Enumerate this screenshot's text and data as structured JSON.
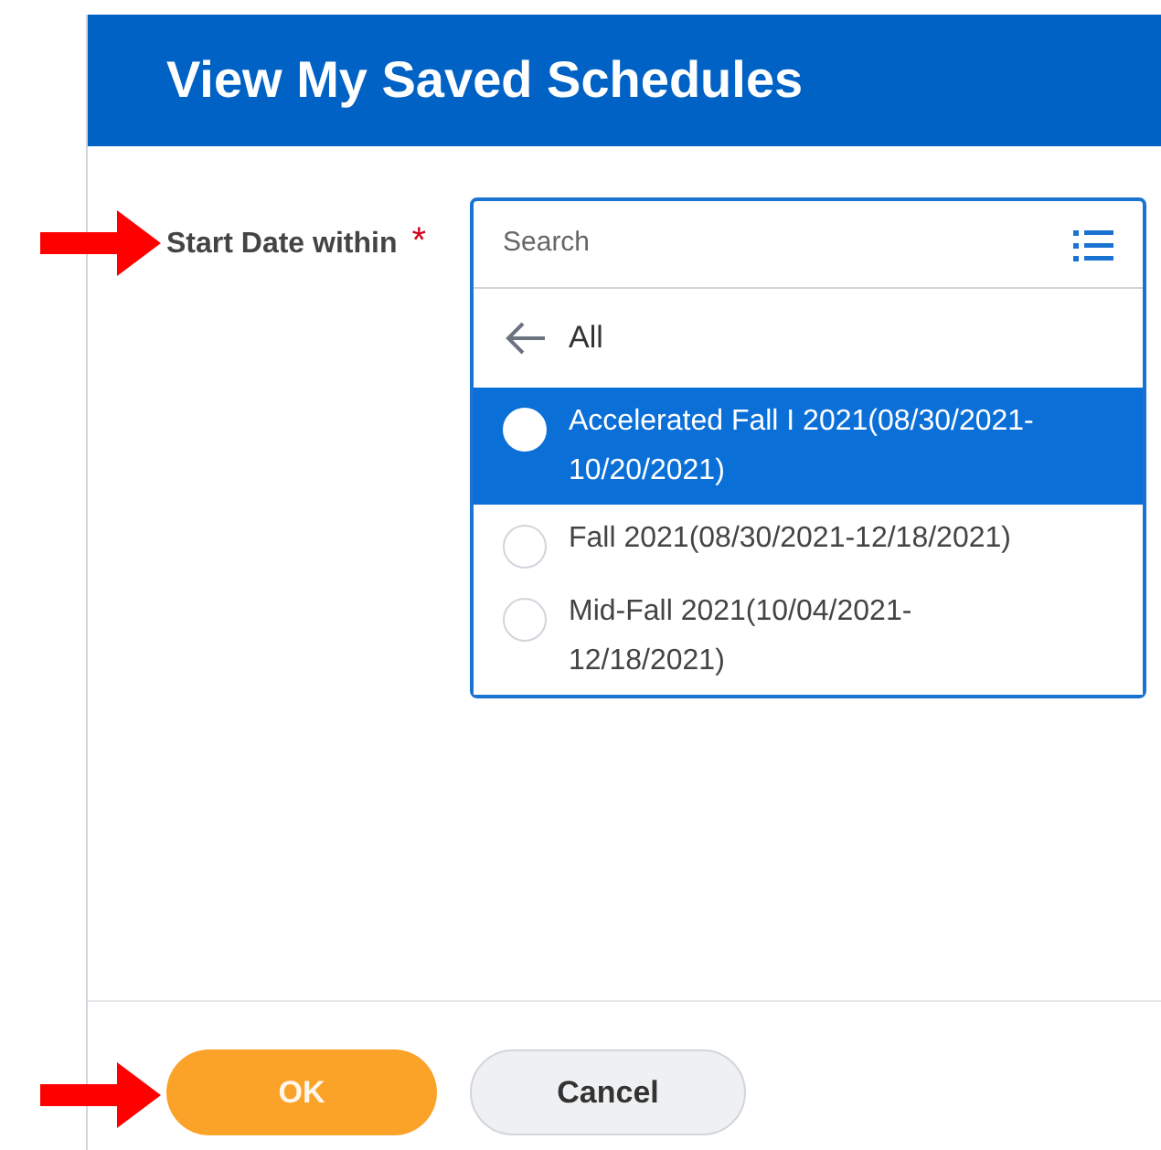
{
  "dialog": {
    "title": "View My Saved Schedules"
  },
  "field": {
    "label": "Start Date within",
    "required_mark": "*",
    "placeholder": "Search",
    "back_label": "All",
    "options": [
      {
        "label": "Accelerated Fall I 2021(08/30/2021-10/20/2021)",
        "selected": true
      },
      {
        "label": "Fall 2021(08/30/2021-12/18/2021)",
        "selected": false
      },
      {
        "label": "Mid-Fall 2021(10/04/2021-12/18/2021)",
        "selected": false
      }
    ]
  },
  "buttons": [
    {
      "label": "OK",
      "kind": "primary"
    },
    {
      "label": "Cancel",
      "kind": "secondary"
    }
  ]
}
